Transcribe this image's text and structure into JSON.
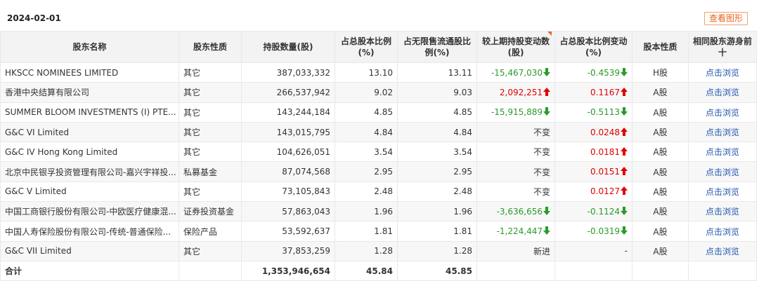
{
  "header": {
    "date": "2024-02-01",
    "view_chart_label": "查看图形"
  },
  "columns": [
    "股东名称",
    "股东性质",
    "持股数量(股)",
    "占总股本比例(%)",
    "占无限售流通股比例(%)",
    "较上期持股变动数(股)",
    "占总股本比例变动(%)",
    "股本性质",
    "相同股东游身前十"
  ],
  "rows": [
    {
      "name": "HKSCC NOMINEES LIMITED",
      "type": "其它",
      "shares": "387,033,332",
      "pct": "13.10",
      "float_pct": "13.11",
      "change": "-15,467,030",
      "change_dir": "down",
      "pct_change": "-0.4539",
      "pct_dir": "down",
      "share_type": "H股",
      "link": "点击浏览"
    },
    {
      "name": "香港中央结算有限公司",
      "type": "其它",
      "shares": "266,537,942",
      "pct": "9.02",
      "float_pct": "9.03",
      "change": "2,092,251",
      "change_dir": "up",
      "pct_change": "0.1167",
      "pct_dir": "up",
      "share_type": "A股",
      "link": "点击浏览"
    },
    {
      "name": "SUMMER BLOOM INVESTMENTS (I) PTE...",
      "type": "其它",
      "shares": "143,244,184",
      "pct": "4.85",
      "float_pct": "4.85",
      "change": "-15,915,889",
      "change_dir": "down",
      "pct_change": "-0.5113",
      "pct_dir": "down",
      "share_type": "A股",
      "link": "点击浏览"
    },
    {
      "name": "G&C VI Limited",
      "type": "其它",
      "shares": "143,015,795",
      "pct": "4.84",
      "float_pct": "4.84",
      "change": "不变",
      "change_dir": "",
      "pct_change": "0.0248",
      "pct_dir": "up",
      "share_type": "A股",
      "link": "点击浏览"
    },
    {
      "name": "G&C IV Hong Kong Limited",
      "type": "其它",
      "shares": "104,626,051",
      "pct": "3.54",
      "float_pct": "3.54",
      "change": "不变",
      "change_dir": "",
      "pct_change": "0.0181",
      "pct_dir": "up",
      "share_type": "A股",
      "link": "点击浏览"
    },
    {
      "name": "北京中民银孚投资管理有限公司-嘉兴宇祥投...",
      "type": "私募基金",
      "shares": "87,074,568",
      "pct": "2.95",
      "float_pct": "2.95",
      "change": "不变",
      "change_dir": "",
      "pct_change": "0.0151",
      "pct_dir": "up",
      "share_type": "A股",
      "link": "点击浏览"
    },
    {
      "name": "G&C V Limited",
      "type": "其它",
      "shares": "73,105,843",
      "pct": "2.48",
      "float_pct": "2.48",
      "change": "不变",
      "change_dir": "",
      "pct_change": "0.0127",
      "pct_dir": "up",
      "share_type": "A股",
      "link": "点击浏览"
    },
    {
      "name": "中国工商银行股份有限公司-中欧医疗健康混...",
      "type": "证券投资基金",
      "shares": "57,863,043",
      "pct": "1.96",
      "float_pct": "1.96",
      "change": "-3,636,656",
      "change_dir": "down",
      "pct_change": "-0.1124",
      "pct_dir": "down",
      "share_type": "A股",
      "link": "点击浏览"
    },
    {
      "name": "中国人寿保险股份有限公司-传统-普通保险...",
      "type": "保险产品",
      "shares": "53,592,637",
      "pct": "1.81",
      "float_pct": "1.81",
      "change": "-1,224,447",
      "change_dir": "down",
      "pct_change": "-0.0319",
      "pct_dir": "down",
      "share_type": "A股",
      "link": "点击浏览"
    },
    {
      "name": "G&C VII Limited",
      "type": "其它",
      "shares": "37,853,259",
      "pct": "1.28",
      "float_pct": "1.28",
      "change": "新进",
      "change_dir": "",
      "pct_change": "-",
      "pct_dir": "",
      "share_type": "A股",
      "link": "点击浏览"
    }
  ],
  "total": {
    "label": "合计",
    "shares": "1,353,946,654",
    "pct": "45.84",
    "float_pct": "45.85"
  },
  "colors": {
    "up": "#e00000",
    "down": "#2a9a2a",
    "link": "#2255aa",
    "accent": "#e8651e"
  }
}
